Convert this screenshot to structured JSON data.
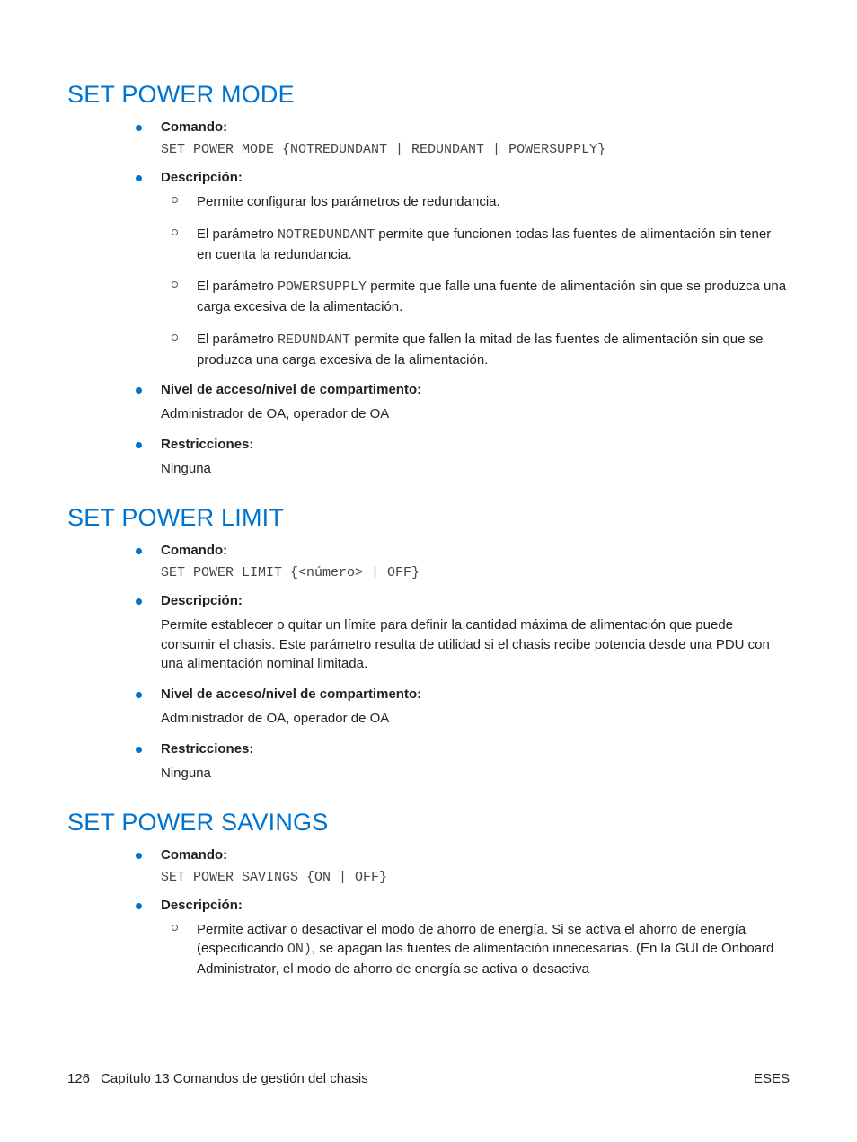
{
  "sections": [
    {
      "title": "SET POWER MODE",
      "items": [
        {
          "label": "Comando:",
          "mono": "SET POWER MODE {NOTREDUNDANT | REDUNDANT | POWERSUPPLY}"
        },
        {
          "label": "Descripción:",
          "sub": [
            {
              "a": "Permite configurar los parámetros de redundancia."
            },
            {
              "a": "El parámetro ",
              "m": "NOTREDUNDANT",
              "b": " permite que funcionen todas las fuentes de alimentación sin tener en cuenta la redundancia."
            },
            {
              "a": "El parámetro ",
              "m": "POWERSUPPLY",
              "b": " permite que falle una fuente de alimentación sin que se produzca una carga excesiva de la alimentación."
            },
            {
              "a": "El parámetro ",
              "m": "REDUNDANT",
              "b": " permite que fallen la mitad de las fuentes de alimentación sin que se produzca una carga excesiva de la alimentación."
            }
          ]
        },
        {
          "label": "Nivel de acceso/nivel de compartimento:",
          "body": "Administrador de OA, operador de OA"
        },
        {
          "label": "Restricciones:",
          "body": "Ninguna"
        }
      ]
    },
    {
      "title": "SET POWER LIMIT",
      "items": [
        {
          "label": "Comando:",
          "mono": "SET POWER LIMIT {<número> | OFF}"
        },
        {
          "label": "Descripción:",
          "body": "Permite establecer o quitar un límite para definir la cantidad máxima de alimentación que puede consumir el chasis. Este parámetro resulta de utilidad si el chasis recibe potencia desde una PDU con una alimentación nominal limitada."
        },
        {
          "label": "Nivel de acceso/nivel de compartimento:",
          "body": "Administrador de OA, operador de OA"
        },
        {
          "label": "Restricciones:",
          "body": "Ninguna"
        }
      ]
    },
    {
      "title": "SET POWER SAVINGS",
      "items": [
        {
          "label": "Comando:",
          "mono": "SET POWER SAVINGS {ON | OFF}"
        },
        {
          "label": "Descripción:",
          "sub": [
            {
              "a": "Permite activar o desactivar el modo de ahorro de energía. Si se activa el ahorro de energía (especificando ",
              "m": "ON)",
              "b": ", se apagan las fuentes de alimentación innecesarias. (En la GUI de Onboard Administrator, el modo de ahorro de energía se activa o desactiva"
            }
          ]
        }
      ]
    }
  ],
  "footer": {
    "page": "126",
    "chapter": "Capítulo 13   Comandos de gestión del chasis",
    "lang": "ESES"
  }
}
